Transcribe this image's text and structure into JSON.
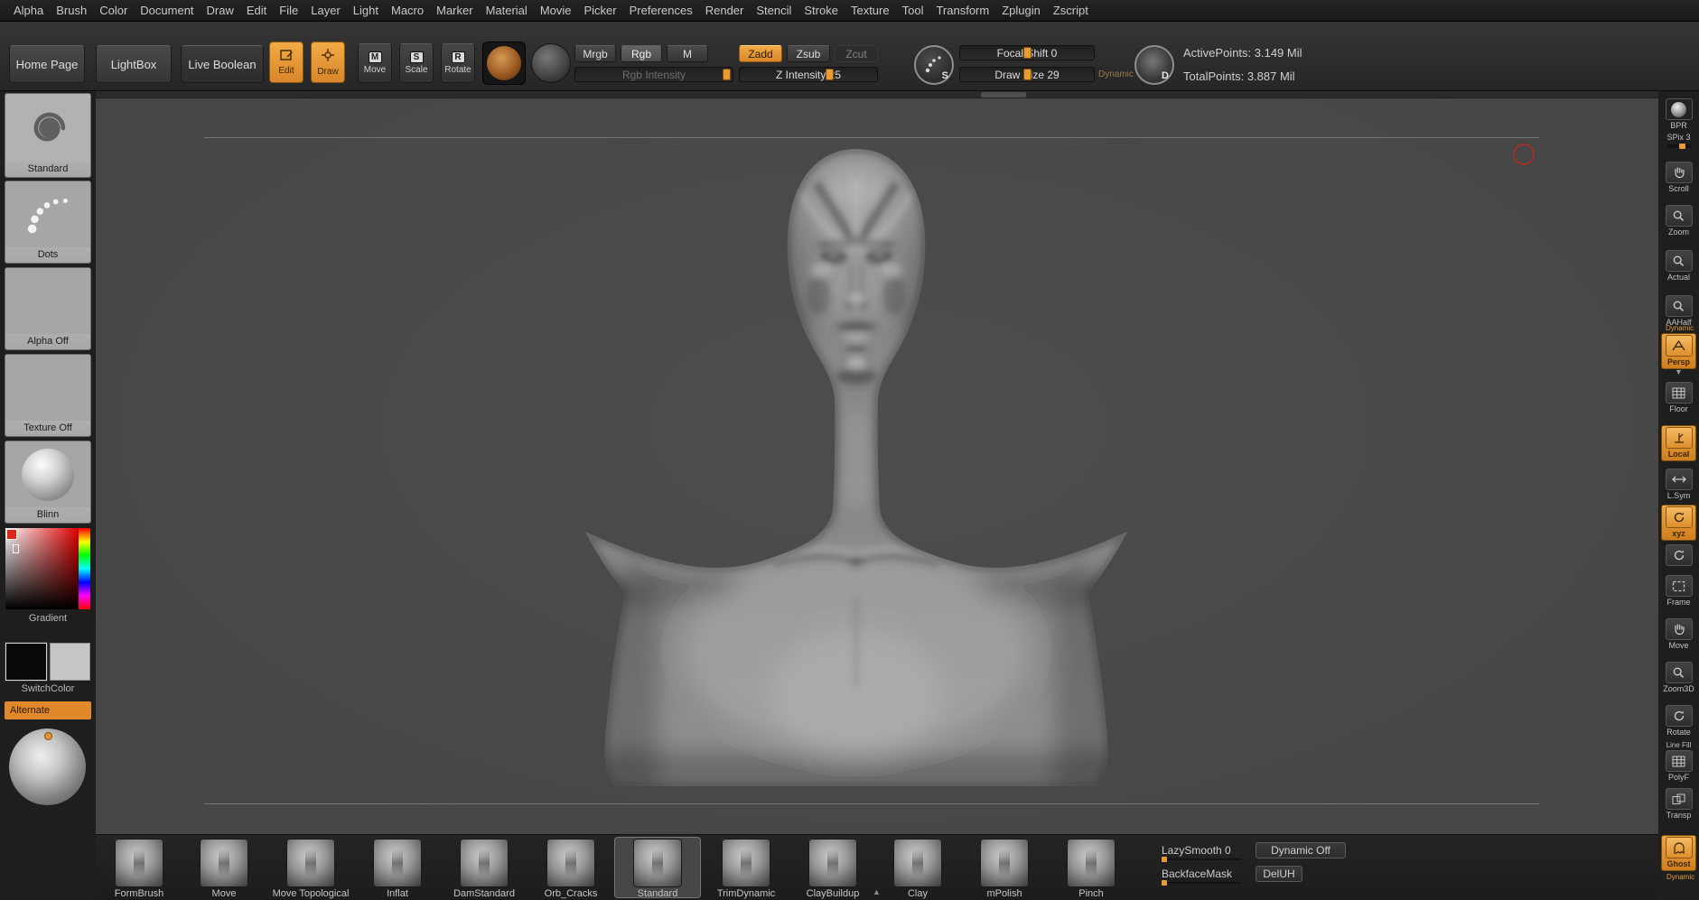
{
  "menu": {
    "items": [
      "Alpha",
      "Brush",
      "Color",
      "Document",
      "Draw",
      "Edit",
      "File",
      "Layer",
      "Light",
      "Macro",
      "Marker",
      "Material",
      "Movie",
      "Picker",
      "Preferences",
      "Render",
      "Stencil",
      "Stroke",
      "Texture",
      "Tool",
      "Transform",
      "Zplugin",
      "Zscript"
    ]
  },
  "topbar": {
    "home_page": "Home Page",
    "lightbox": "LightBox",
    "live_boolean": "Live Boolean",
    "edit": "Edit",
    "draw": "Draw",
    "move": "Move",
    "scale": "Scale",
    "rotate": "Rotate",
    "move_icon": "M",
    "scale_icon": "S",
    "rotate_icon": "R",
    "mrgb": "Mrgb",
    "rgb": "Rgb",
    "m": "M",
    "zadd": "Zadd",
    "zsub": "Zsub",
    "zcut": "Zcut",
    "rgb_intensity_label": "Rgb Intensity",
    "z_intensity_label": "Z Intensity 25",
    "focal_shift_label": "Focal Shift 0",
    "draw_size_label": "Draw Size 29",
    "dynamic_label": "Dynamic",
    "stroke_icon_letter": "S",
    "depth_icon_letter": "D",
    "active_points": "ActivePoints: 3.149 Mil",
    "total_points": "TotalPoints: 3.887 Mil"
  },
  "left_shelf": {
    "brush": "Standard",
    "stroke": "Dots",
    "alpha": "Alpha Off",
    "texture": "Texture Off",
    "material": "Blinn",
    "gradient": "Gradient",
    "switch_color": "SwitchColor",
    "alternate": "Alternate"
  },
  "right_shelf": {
    "bpr": "BPR",
    "spix": "SPix 3",
    "scroll": "Scroll",
    "zoom": "Zoom",
    "actual": "Actual",
    "aahalf": "AAHalf",
    "persp_dynamic": "Dynamic",
    "persp": "Persp",
    "floor": "Floor",
    "local": "Local",
    "lsym": "L.Sym",
    "xyz": "xyz",
    "frame": "Frame",
    "move": "Move",
    "zoom3d": "Zoom3D",
    "rotate": "Rotate",
    "line_fill": "Line Fill",
    "polyf": "PolyF",
    "transp": "Transp",
    "ghost": "Ghost",
    "ghost_dynamic": "Dynamic"
  },
  "tray": {
    "brushes": [
      "FormBrush",
      "Move",
      "Move Topological",
      "Inflat",
      "DamStandard",
      "Orb_Cracks",
      "Standard",
      "TrimDynamic",
      "ClayBuildup",
      "Clay",
      "mPolish",
      "Pinch"
    ],
    "selected_brush": "Standard",
    "lazysmooth": "LazySmooth 0",
    "dynamic_off": "Dynamic Off",
    "backfacemask": "BackfaceMask",
    "deluh": "DelUH"
  },
  "colors": {
    "accent_orange": "#e89b33",
    "canvas_bg": "#494949",
    "brush_cursor_red": "#a03028"
  }
}
